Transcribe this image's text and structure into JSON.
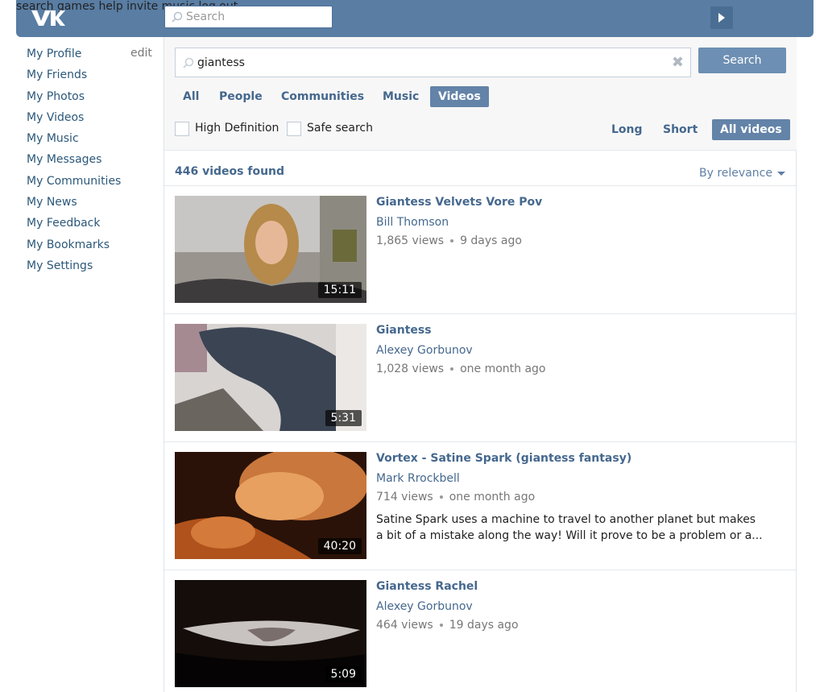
{
  "topbar": {
    "search_placeholder": "Search",
    "nav": [
      "search",
      "games",
      "help",
      "invite",
      "music",
      "log out"
    ]
  },
  "sidebar": {
    "items": [
      {
        "label": "My Profile"
      },
      {
        "label": "My Friends"
      },
      {
        "label": "My Photos"
      },
      {
        "label": "My Videos"
      },
      {
        "label": "My Music"
      },
      {
        "label": "My Messages"
      },
      {
        "label": "My Communities"
      },
      {
        "label": "My News"
      },
      {
        "label": "My Feedback"
      },
      {
        "label": "My Bookmarks"
      },
      {
        "label": "My Settings"
      }
    ],
    "edit_label": "edit"
  },
  "search": {
    "query": "giantess",
    "button_label": "Search",
    "clear_icon": "close-icon"
  },
  "tabs": [
    {
      "label": "All"
    },
    {
      "label": "People"
    },
    {
      "label": "Communities"
    },
    {
      "label": "Music"
    },
    {
      "label": "Videos",
      "active": true
    }
  ],
  "filters": {
    "hd_label": "High Definition",
    "safe_label": "Safe search",
    "duration": [
      {
        "label": "Long"
      },
      {
        "label": "Short"
      },
      {
        "label": "All videos",
        "active": true
      }
    ]
  },
  "results": {
    "count_text": "446 videos found",
    "sort_label": "By relevance"
  },
  "videos": [
    {
      "title": "Giantess Velvets Vore Pov",
      "author": "Bill Thomson",
      "views": "1,865 views",
      "age": "9 days ago",
      "duration": "15:11",
      "desc": ""
    },
    {
      "title": "Giantess",
      "author": "Alexey Gorbunov",
      "views": "1,028 views",
      "age": "one month ago",
      "duration": "5:31",
      "desc": ""
    },
    {
      "title": "Vortex - Satine Spark (giantess fantasy)",
      "author": "Mark Rrockbell",
      "views": "714 views",
      "age": "one month ago",
      "duration": "40:20",
      "desc": "Satine Spark uses a machine to travel to another planet but makes a bit of a mistake along the way! Will it prove to be a problem or a..."
    },
    {
      "title": "Giantess Rachel",
      "author": "Alexey Gorbunov",
      "views": "464 views",
      "age": "19 days ago",
      "duration": "5:09",
      "desc": ""
    }
  ],
  "colors": {
    "header": "#597da3",
    "link": "#45688e",
    "button": "#6d8fb3"
  }
}
